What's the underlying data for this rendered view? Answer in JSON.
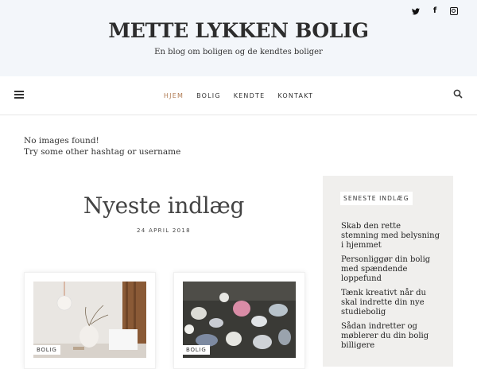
{
  "header": {
    "title": "METTE LYKKEN BOLIG",
    "tagline": "En blog om boligen og de kendtes boliger",
    "social": [
      "twitter-icon",
      "facebook-icon",
      "instagram-icon"
    ]
  },
  "nav": {
    "items": [
      {
        "label": "HJEM",
        "active": true
      },
      {
        "label": "BOLIG",
        "active": false
      },
      {
        "label": "KENDTE",
        "active": false
      },
      {
        "label": "KONTAKT",
        "active": false
      }
    ]
  },
  "notice": {
    "line1": "No images found!",
    "line2": "Try some other hashtag or username"
  },
  "main": {
    "title": "Nyeste indlæg",
    "date": "24 APRIL 2018",
    "cards": [
      {
        "tag": "BOLIG"
      },
      {
        "tag": "BOLIG"
      }
    ]
  },
  "sidebar": {
    "title": "SENESTE INDLÆG",
    "posts": [
      "Skab den rette stemning med belysning i hjemmet",
      "Personliggør din bolig med spændende loppefund",
      "Tænk kreativt når du skal indrette din nye studiebolig",
      "Sådan indretter og møblerer du din bolig billigere"
    ]
  },
  "colors": {
    "header_bg": "#f3f6fa",
    "accent": "#b07a52",
    "sidebar_bg": "#f0efed"
  }
}
